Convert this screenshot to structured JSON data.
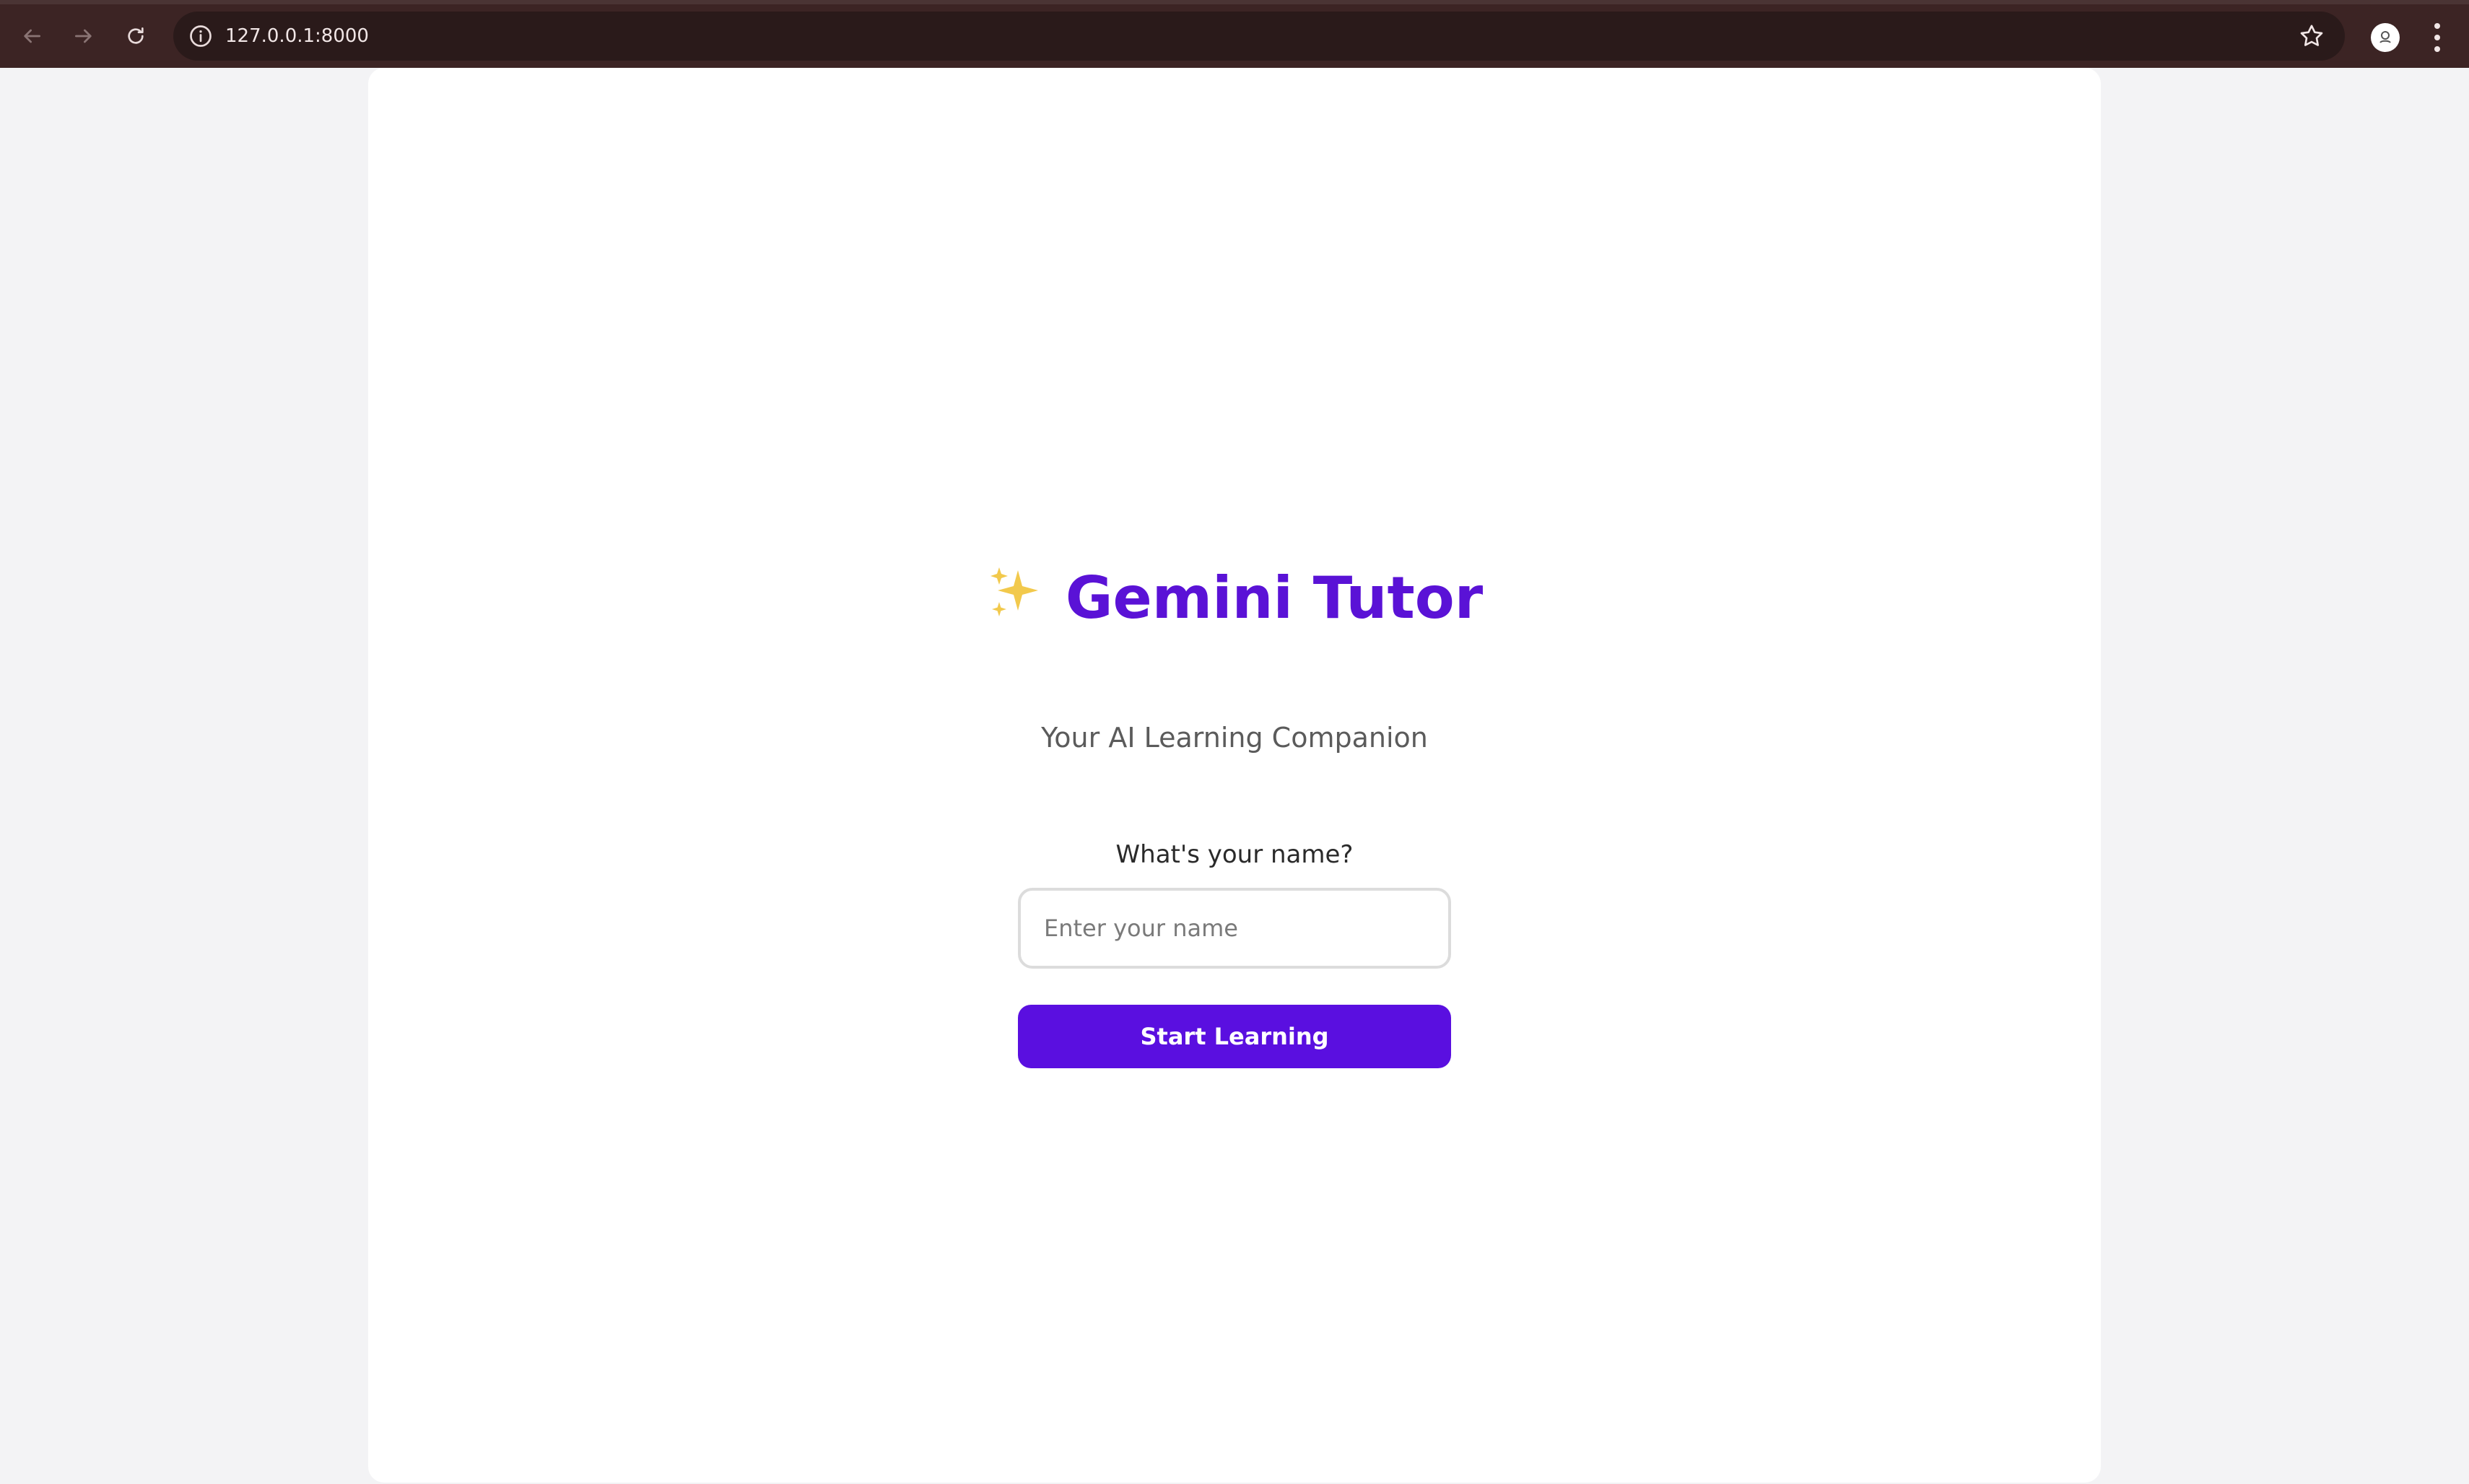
{
  "browser": {
    "url": "127.0.0.1:8000"
  },
  "app": {
    "title": "Gemini Tutor",
    "subtitle": "Your AI Learning Companion",
    "name_prompt": "What's your name?",
    "name_input": {
      "value": "",
      "placeholder": "Enter your name"
    },
    "start_button_label": "Start Learning"
  },
  "icons": {
    "title_icon": "sparkles-icon"
  },
  "colors": {
    "accent": "#5a0fe0",
    "title": "#5a12d6",
    "browser_chrome": "#3c2424",
    "sparkle": "#f2c94c"
  }
}
